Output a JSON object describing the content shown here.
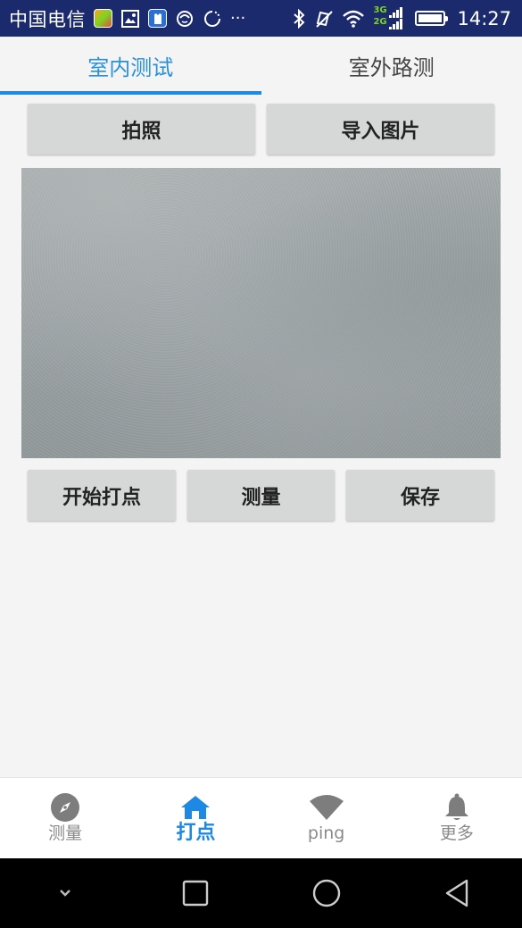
{
  "status_bar": {
    "carrier": "中国电信",
    "network_3g": "3G",
    "network_2g": "2G",
    "time": "14:27",
    "more_indicator": "···"
  },
  "tabs": [
    {
      "label": "室内测试",
      "active": true
    },
    {
      "label": "室外路测",
      "active": false
    }
  ],
  "top_actions": {
    "photo_label": "拍照",
    "import_label": "导入图片"
  },
  "bottom_actions": {
    "start_label": "开始打点",
    "measure_label": "测量",
    "save_label": "保存"
  },
  "bottom_nav": [
    {
      "label": "测量",
      "icon": "compass-icon",
      "active": false
    },
    {
      "label": "打点",
      "icon": "home-icon",
      "active": true
    },
    {
      "label": "ping",
      "icon": "wifi-icon",
      "active": false
    },
    {
      "label": "更多",
      "icon": "bell-icon",
      "active": false
    }
  ],
  "colors": {
    "status_bar_bg": "#1a2a6c",
    "accent": "#1e88e5",
    "button_bg": "#d6d7d7",
    "inactive_nav": "#8a8a8a"
  }
}
